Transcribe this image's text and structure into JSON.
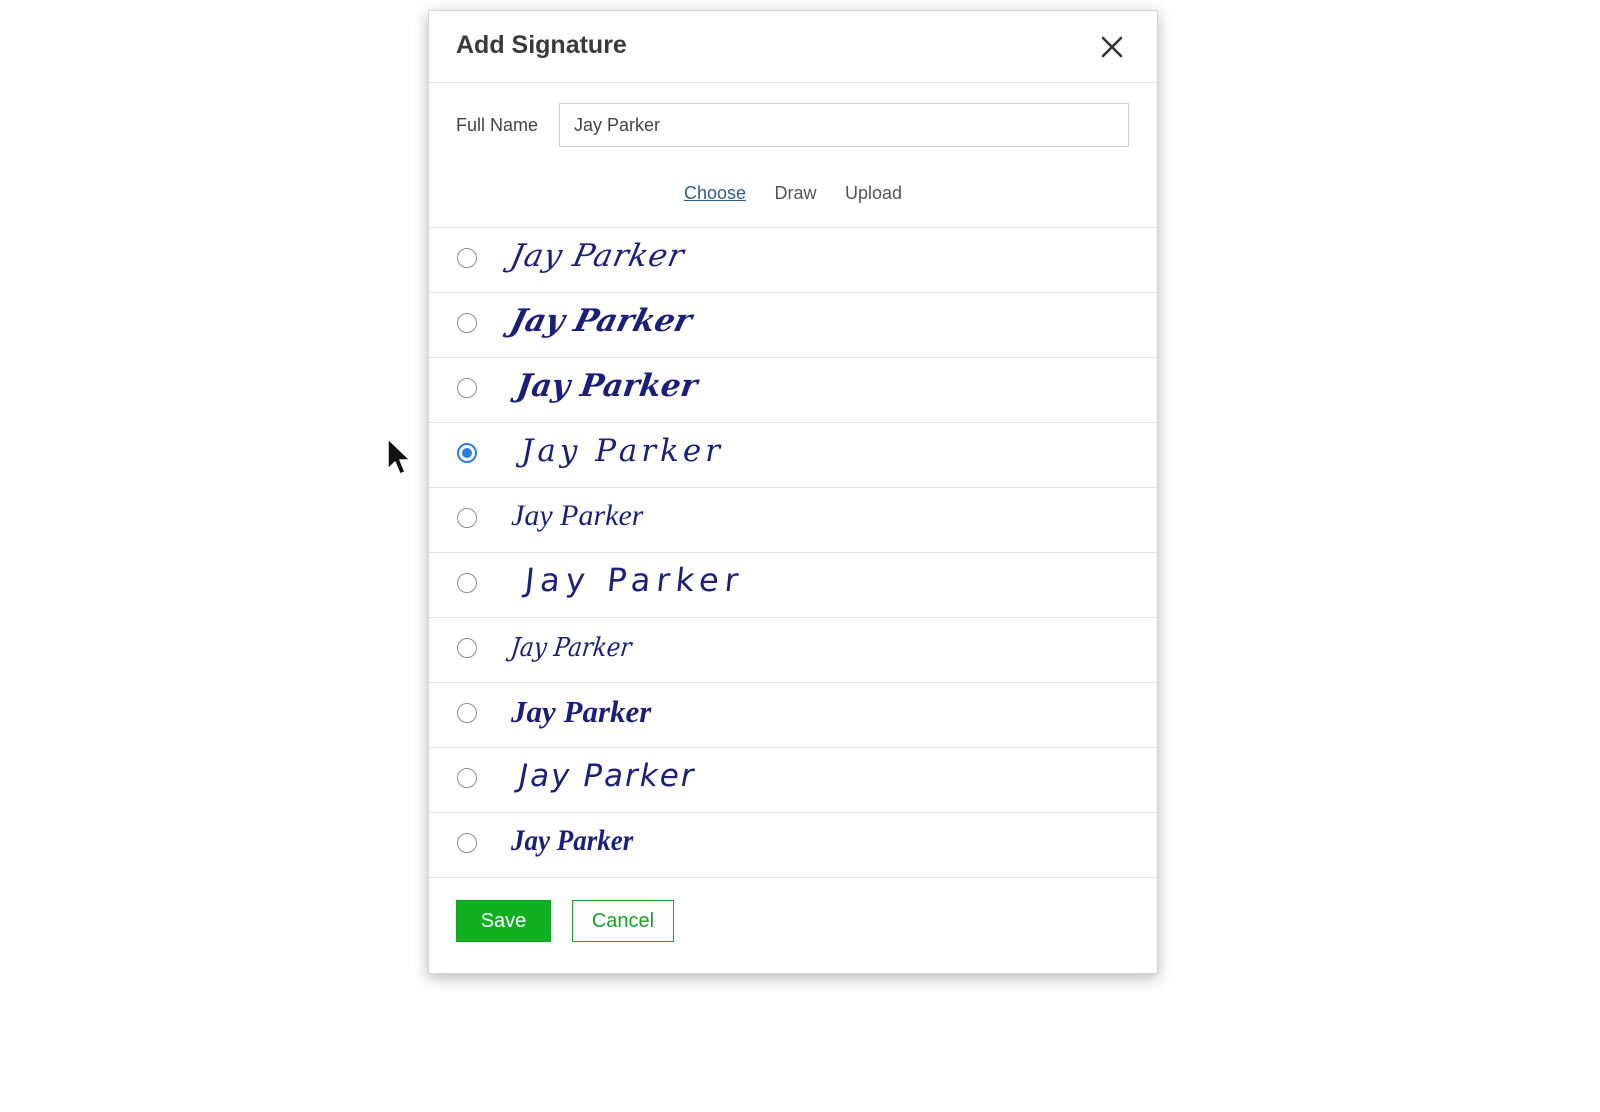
{
  "dialog": {
    "title": "Add Signature",
    "close_icon": "close-icon"
  },
  "full_name": {
    "label": "Full Name",
    "value": "Jay Parker"
  },
  "tabs": [
    {
      "label": "Choose",
      "active": true
    },
    {
      "label": "Draw",
      "active": false
    },
    {
      "label": "Upload",
      "active": false
    }
  ],
  "signatures": [
    {
      "text": "Jay Parker",
      "selected": false
    },
    {
      "text": "Jay Parker",
      "selected": false
    },
    {
      "text": "Jay Parker",
      "selected": false
    },
    {
      "text": "Jay Parker",
      "selected": true
    },
    {
      "text": "Jay Parker",
      "selected": false
    },
    {
      "text": "Jay Parker",
      "selected": false
    },
    {
      "text": "Jay Parker",
      "selected": false
    },
    {
      "text": "Jay Parker",
      "selected": false
    },
    {
      "text": "Jay Parker",
      "selected": false
    },
    {
      "text": "Jay Parker",
      "selected": false
    }
  ],
  "footer": {
    "save_label": "Save",
    "cancel_label": "Cancel"
  },
  "colors": {
    "signature_ink": "#1b1f7a",
    "radio_selected": "#2a7de0",
    "save_green": "#10b021",
    "cancel_green": "#17a525",
    "active_tab": "#2d5d8b"
  }
}
